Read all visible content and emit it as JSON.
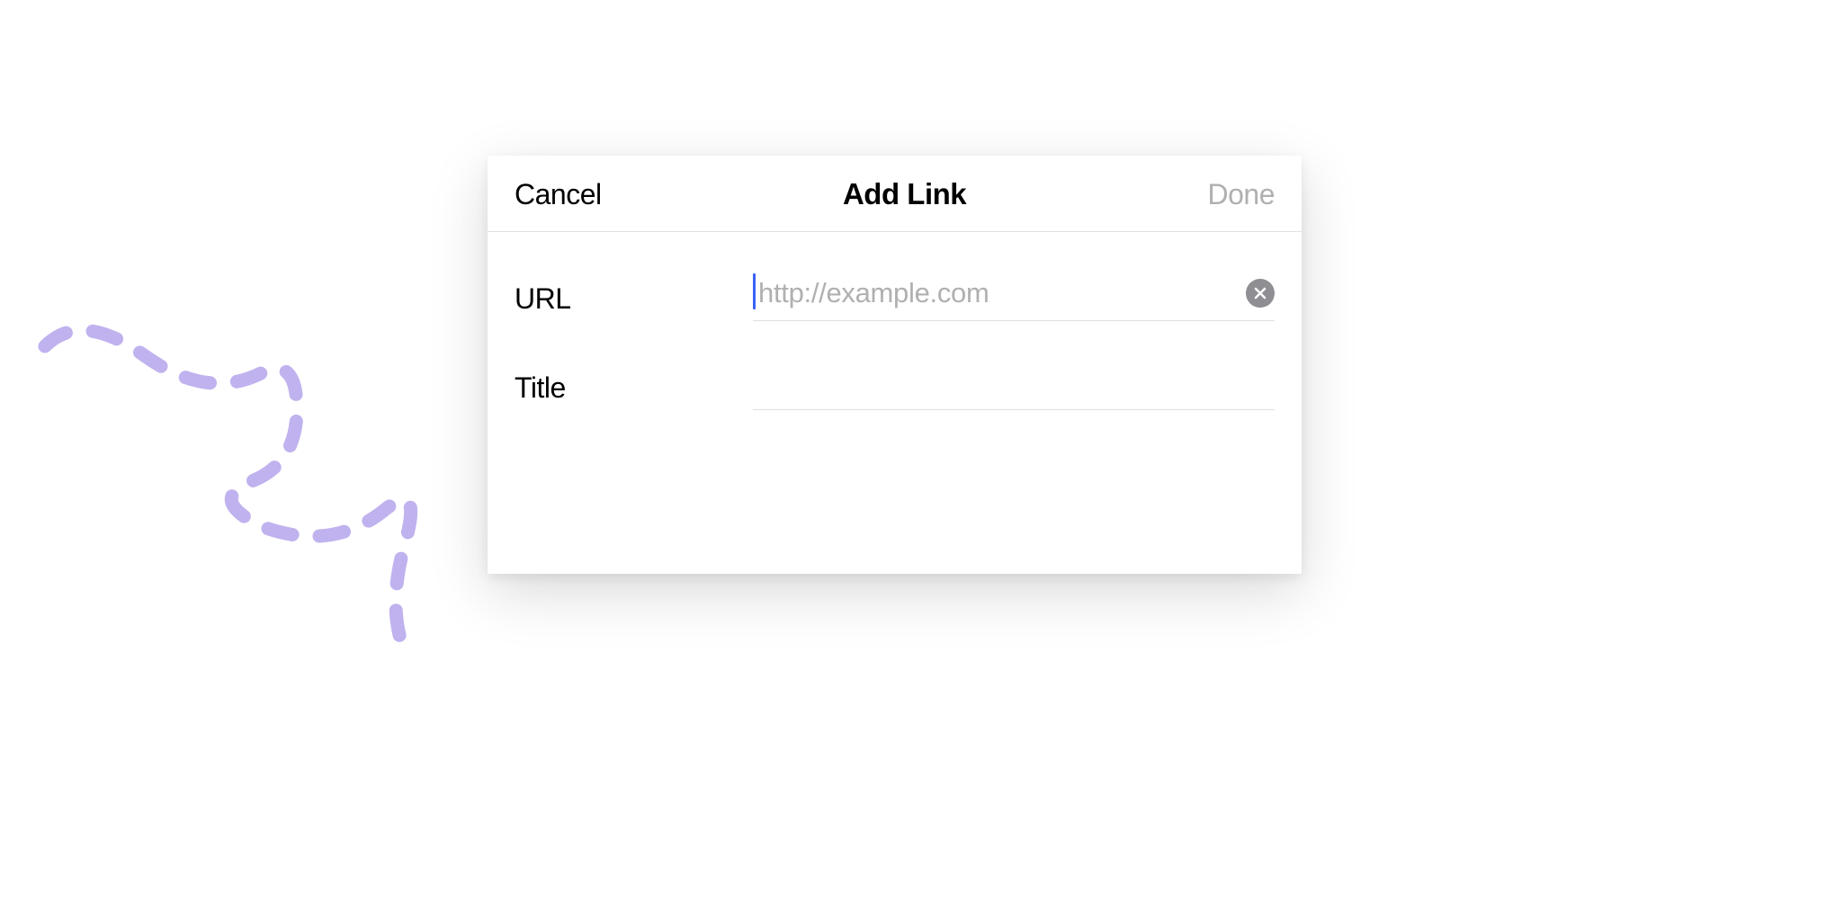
{
  "modal": {
    "header": {
      "cancel_label": "Cancel",
      "title": "Add Link",
      "done_label": "Done"
    },
    "fields": {
      "url": {
        "label": "URL",
        "placeholder": "http://example.com",
        "value": ""
      },
      "title": {
        "label": "Title",
        "placeholder": "",
        "value": ""
      }
    }
  },
  "decoration": {
    "squiggle_color": "#c0b2ee"
  }
}
